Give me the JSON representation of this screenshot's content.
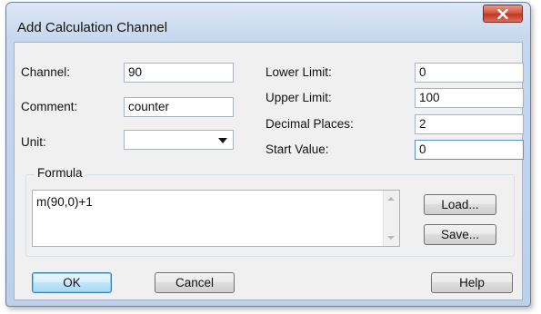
{
  "window": {
    "title": "Add Calculation Channel",
    "close_glyph": "X"
  },
  "fields": {
    "channel": {
      "label": "Channel:",
      "value": "90"
    },
    "comment": {
      "label": "Comment:",
      "value": "counter"
    },
    "unit": {
      "label": "Unit:",
      "value": ""
    },
    "lower_limit": {
      "label": "Lower Limit:",
      "value": "0"
    },
    "upper_limit": {
      "label": "Upper Limit:",
      "value": "100"
    },
    "decimal_places": {
      "label": "Decimal Places:",
      "value": "2"
    },
    "start_value": {
      "label": "Start Value:",
      "value": "0"
    }
  },
  "formula": {
    "group_label": "Formula",
    "text": "m(90,0)+1",
    "load_label": "Load...",
    "save_label": "Save..."
  },
  "buttons": {
    "ok": "OK",
    "cancel": "Cancel",
    "help": "Help"
  },
  "colors": {
    "close_button": "#c23621",
    "default_button_border": "#3c7fb1",
    "focus_border": "#5b8fc6"
  }
}
